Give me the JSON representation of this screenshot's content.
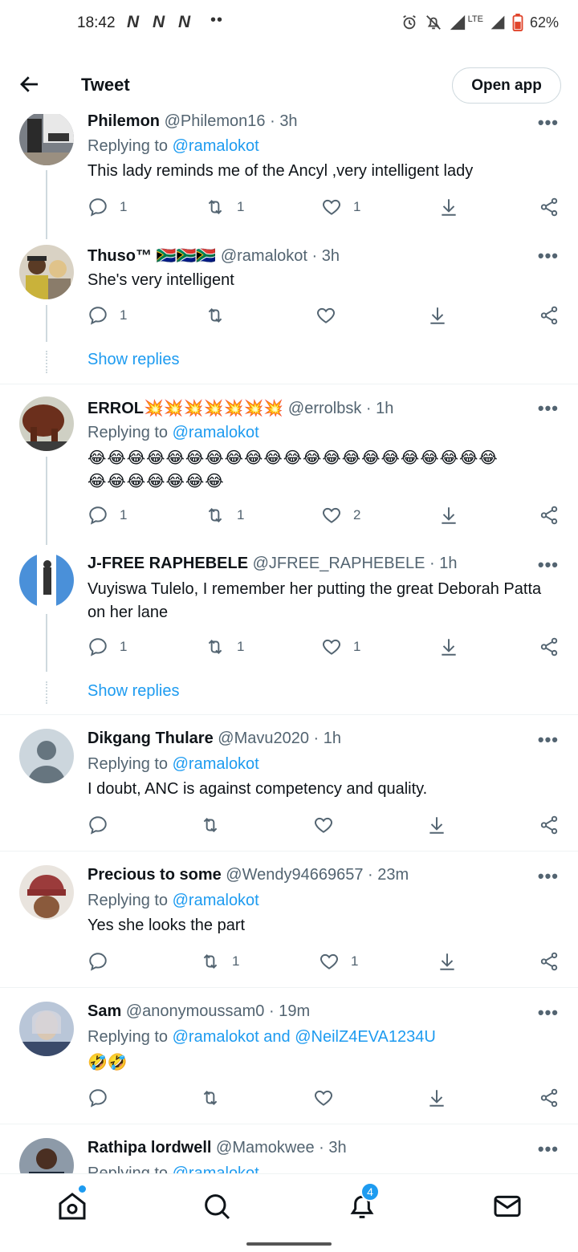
{
  "status_bar": {
    "time": "18:42",
    "network_letters": [
      "N",
      "N",
      "N"
    ],
    "more_dots": "••",
    "lte": "LTE",
    "battery": "62%"
  },
  "header": {
    "title": "Tweet",
    "open_app": "Open app"
  },
  "tweets": [
    {
      "name": "Philemon",
      "handle": "@Philemon16",
      "time": "3h",
      "replying_prefix": "Replying to",
      "replying_to": "@ramalokot",
      "text": "This lady reminds me of the Ancyl ,very intelligent lady",
      "replies": "1",
      "retweets": "1",
      "likes": "1"
    },
    {
      "name": "Thuso™",
      "name_emoji": "🇿🇦🇿🇦🇿🇦",
      "handle": "@ramalokot",
      "time": "3h",
      "text": "She's very intelligent",
      "replies": "1",
      "retweets": "",
      "likes": "",
      "show_replies": "Show replies"
    },
    {
      "name": "ERROL",
      "name_emoji": "💥💥💥💥💥💥💥",
      "handle": "@errolbsk",
      "time": "1h",
      "replying_prefix": "Replying to",
      "replying_to": "@ramalokot",
      "text_line1": "😂😂😂😂😂😂😂😂😂😂😂😂😂😂😂😂😂😂😂😂😂",
      "text_line2": "😂😂😂😂😂😂😂",
      "replies": "1",
      "retweets": "1",
      "likes": "2"
    },
    {
      "name": "J-FREE RAPHEBELE",
      "handle": "@JFREE_RAPHEBELE",
      "time": "1h",
      "text": "Vuyiswa Tulelo, I remember her putting the great Deborah Patta on her lane",
      "replies": "1",
      "retweets": "1",
      "likes": "1",
      "show_replies": "Show replies"
    },
    {
      "name": "Dikgang Thulare",
      "handle": "@Mavu2020",
      "time": "1h",
      "replying_prefix": "Replying to",
      "replying_to": "@ramalokot",
      "text": "I doubt, ANC is against competency and quality.",
      "replies": "",
      "retweets": "",
      "likes": ""
    },
    {
      "name": "Precious to some",
      "handle": "@Wendy94669657",
      "time": "23m",
      "replying_prefix": "Replying to",
      "replying_to": "@ramalokot",
      "text": "Yes she looks the part",
      "replies": "",
      "retweets": "1",
      "likes": "1"
    },
    {
      "name": "Sam",
      "handle": "@anonymoussam0",
      "time": "19m",
      "replying_prefix": "Replying to",
      "replying_to": "@ramalokot and @NeilZ4EVA1234U",
      "text": "🤣🤣",
      "replies": "",
      "retweets": "",
      "likes": ""
    },
    {
      "name": "Rathipa lordwell",
      "handle": "@Mamokwee",
      "time": "3h",
      "replying_prefix": "Replying to",
      "replying_to": "@ramalokot"
    }
  ],
  "more_label": "•••",
  "bottom_nav": {
    "notifications_count": "4"
  },
  "colors": {
    "accent": "#1d9bf0",
    "muted": "#536471",
    "border": "#eff3f4"
  }
}
